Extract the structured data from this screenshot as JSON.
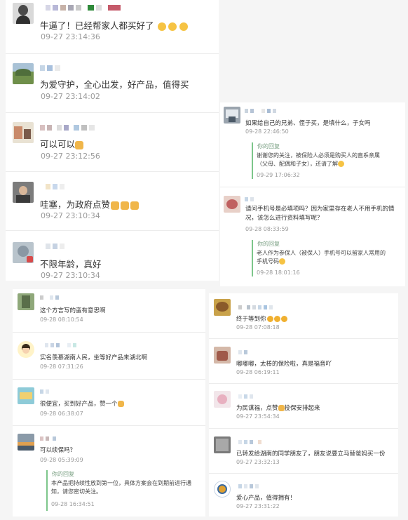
{
  "top_left": [
    {
      "text": "牛逼了！已经帮家人都买好了",
      "emoji_suffix": "😍😍😍",
      "time": "09-27 23:14:36"
    },
    {
      "text": "为爱守护，全心出发，好产品，值得买",
      "emoji_suffix": "",
      "time": "09-27 23:14:02"
    },
    {
      "text": "可以可以",
      "emoji_suffix": "👍",
      "time": "09-27 23:12:56"
    },
    {
      "text": "哇塞，为政府点赞",
      "emoji_suffix": "👍👍👍",
      "time": "09-27 23:10:34"
    },
    {
      "text": "不限年龄，真好",
      "emoji_suffix": "",
      "time": "09-27 23:10:34"
    }
  ],
  "top_right": [
    {
      "text": "如果给自己的兄弟、侄子买，是填什么，子女吗",
      "time": "09-28 22:46:50",
      "reply_label": "你的回复",
      "reply_text": "谢谢您的关注，被保险人必须是购买人的直系亲属（父母、配偶和子女），还请了解",
      "reply_emoji": "😊",
      "reply_time": "09-29 17:06:32"
    },
    {
      "text": "请问手机号是必填项吗？因为家里存在老人不用手机的情况，该怎么进行资料填写呢？",
      "time": "09-28 08:33:59",
      "reply_label": "你的回复",
      "reply_text": "老人作为参保人（被保人）手机号可以留家人常用的手机号码",
      "reply_emoji": "😊",
      "reply_time": "09-28 18:01:16"
    }
  ],
  "bottom_left": [
    {
      "text": "这个方言写的蛮有意思啊",
      "emoji_suffix": "",
      "time": "09-28 08:10:54"
    },
    {
      "text": "实名羡慕湖南人民，坐等好产品来湖北啊",
      "emoji_suffix": "",
      "time": "09-28 07:31:26"
    },
    {
      "text": "很便宜，买到好产品，赞一个",
      "emoji_suffix": "👍",
      "time": "09-28 06:38:07"
    },
    {
      "text": "可以续保吗？",
      "emoji_suffix": "",
      "time": "09-28 05:39:09",
      "reply_label": "你的回复",
      "reply_text": "本产品把持续性放到第一位，具体方案会在到期前进行通知，请您密切关注。",
      "reply_time": "09-28 16:34:51"
    }
  ],
  "bottom_right": [
    {
      "text": "终于等到你",
      "emoji_suffix": "😸😸😸",
      "time": "09-28 07:08:18"
    },
    {
      "text": "嘟嘟嘟，太棒的保险啦，真是福音吖",
      "emoji_suffix": "",
      "time": "09-28 06:19:11"
    },
    {
      "text": "为民谋福，点赞",
      "emoji_suffix": "👍",
      "text2": "投保安排起来",
      "time": "09-27 23:54:34"
    },
    {
      "text": "已转发给湖南的同学朋友了，朋友说要立马替爸妈买一份",
      "emoji_suffix": "",
      "time": "09-27 23:32:13"
    },
    {
      "text": "爱心产品，值得拥有！",
      "emoji_suffix": "",
      "time": "09-27 23:31:22"
    }
  ],
  "colors": {
    "time": "#9a9a9a",
    "reply_bar": "#7dc68b",
    "reply_label": "#7aa083",
    "panel_bg": "#f3f3f3"
  }
}
